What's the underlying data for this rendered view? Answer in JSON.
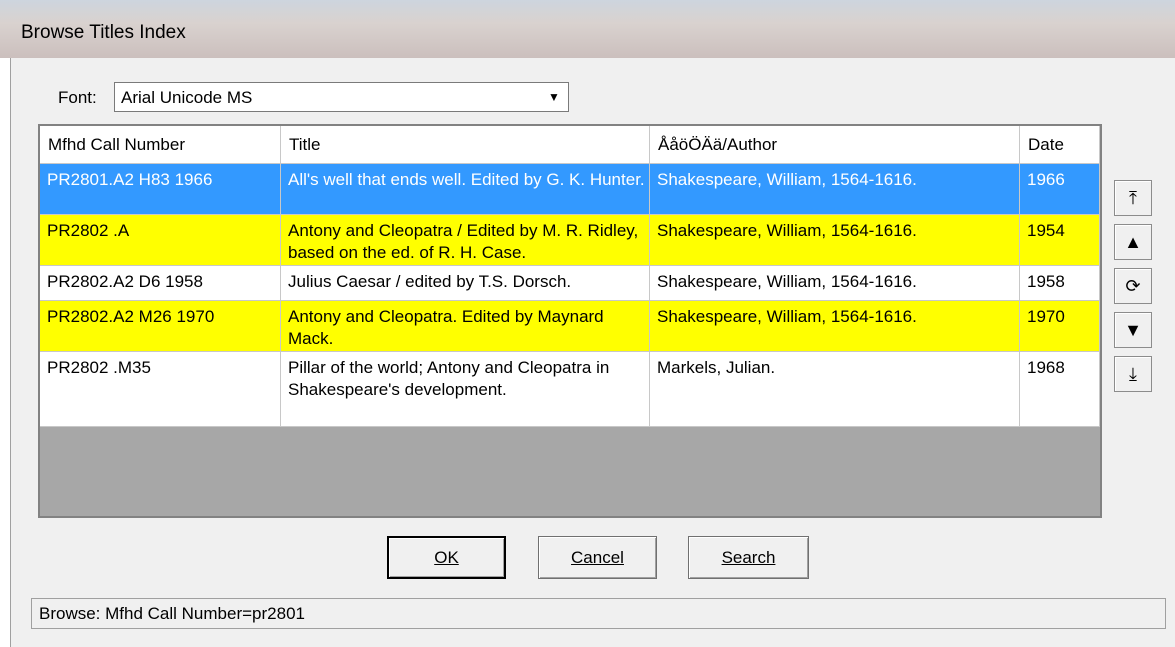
{
  "window": {
    "title": "Browse Titles Index"
  },
  "font": {
    "label": "Font:",
    "value": "Arial Unicode MS"
  },
  "columns": [
    "Mfhd Call Number",
    "Title",
    "ÅåöÖÄä/Author",
    "Date"
  ],
  "rows": [
    {
      "call": "PR2801.A2 H83 1966",
      "title": "All's well that ends well. Edited by G. K. Hunter.",
      "author": "Shakespeare, William, 1564-1616.",
      "date": "1966",
      "state": "selected"
    },
    {
      "call": "PR2802 .A",
      "title": "Antony and Cleopatra / Edited by M. R. Ridley, based on the ed. of R. H. Case.",
      "author": "Shakespeare, William, 1564-1616.",
      "date": "1954",
      "state": "highlight"
    },
    {
      "call": "PR2802.A2 D6 1958",
      "title": "Julius Caesar / edited by T.S. Dorsch.",
      "author": "Shakespeare, William, 1564-1616.",
      "date": "1958",
      "state": "normal"
    },
    {
      "call": "PR2802.A2 M26 1970",
      "title": "Antony and Cleopatra. Edited by Maynard Mack.",
      "author": "Shakespeare, William, 1564-1616.",
      "date": "1970",
      "state": "highlight"
    },
    {
      "call": "PR2802 .M35",
      "title": "Pillar of the world; Antony and Cleopatra in Shakespeare's development.",
      "author": "Markels, Julian.",
      "date": "1968",
      "state": "normal"
    }
  ],
  "nav_buttons": [
    {
      "name": "first-record-icon",
      "glyph": "⤒"
    },
    {
      "name": "previous-record-icon",
      "glyph": "▲"
    },
    {
      "name": "refresh-icon",
      "glyph": "⟳"
    },
    {
      "name": "next-record-icon",
      "glyph": "▼"
    },
    {
      "name": "last-record-icon",
      "glyph": "⤓"
    }
  ],
  "buttons": {
    "ok": "OK",
    "cancel": "Cancel",
    "search": "Search"
  },
  "status": {
    "text": "Browse: Mfhd Call Number=pr2801"
  },
  "colors": {
    "selected_bg": "#3399ff",
    "selected_fg": "#ffffff",
    "highlight_bg": "#ffff00",
    "normal_bg": "#ffffff",
    "empty_bg": "#a7a7a7"
  }
}
